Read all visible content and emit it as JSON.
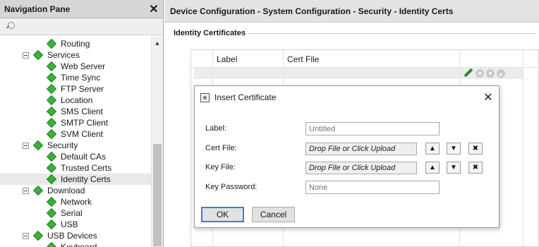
{
  "nav": {
    "title": "Navigation Pane",
    "close_icon": "close-icon",
    "search_icon": "search-icon",
    "items": [
      {
        "label": "Routing",
        "level": 2,
        "expander": false
      },
      {
        "label": "Services",
        "level": 1,
        "expander": true
      },
      {
        "label": "Web Server",
        "level": 2,
        "expander": false
      },
      {
        "label": "Time Sync",
        "level": 2,
        "expander": false
      },
      {
        "label": "FTP Server",
        "level": 2,
        "expander": false
      },
      {
        "label": "Location",
        "level": 2,
        "expander": false
      },
      {
        "label": "SMS Client",
        "level": 2,
        "expander": false
      },
      {
        "label": "SMTP Client",
        "level": 2,
        "expander": false
      },
      {
        "label": "SVM Client",
        "level": 2,
        "expander": false
      },
      {
        "label": "Security",
        "level": 1,
        "expander": true
      },
      {
        "label": "Default CAs",
        "level": 2,
        "expander": false
      },
      {
        "label": "Trusted Certs",
        "level": 2,
        "expander": false
      },
      {
        "label": "Identity Certs",
        "level": 2,
        "expander": false,
        "selected": true
      },
      {
        "label": "Download",
        "level": 1,
        "expander": true
      },
      {
        "label": "Network",
        "level": 2,
        "expander": false
      },
      {
        "label": "Serial",
        "level": 2,
        "expander": false
      },
      {
        "label": "USB",
        "level": 2,
        "expander": false
      },
      {
        "label": "USB Devices",
        "level": 1,
        "expander": true
      },
      {
        "label": "Keyboard",
        "level": 2,
        "expander": false
      }
    ]
  },
  "main": {
    "breadcrumb": "Device Configuration - System Configuration - Security - Identity Certs",
    "section_title": "Identity Certificates",
    "table": {
      "columns": [
        "Label",
        "Cert File"
      ],
      "row_actions": [
        "edit-icon",
        "remove-icon",
        "move-down-icon",
        "move-up-icon"
      ]
    }
  },
  "dialog": {
    "title": "Insert Certificate",
    "fields": {
      "label": {
        "label": "Label:",
        "placeholder": "Untitled",
        "value": ""
      },
      "cert_file": {
        "label": "Cert File:",
        "drop_text": "Drop File or Click Upload"
      },
      "key_file": {
        "label": "Key File:",
        "drop_text": "Drop File or Click Upload"
      },
      "key_password": {
        "label": "Key Password:",
        "placeholder": "None",
        "value": ""
      }
    },
    "ok_label": "OK",
    "cancel_label": "Cancel"
  },
  "colors": {
    "accent_green": "#3bb13b",
    "ok_border": "#3c7fd3",
    "header_bg": "#d6d6d6"
  }
}
